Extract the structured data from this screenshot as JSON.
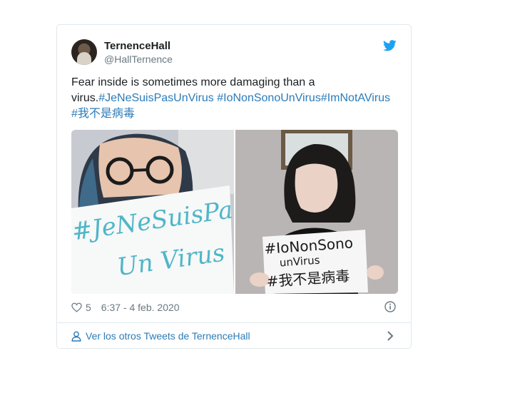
{
  "tweet": {
    "author_name": "TernenceHall",
    "author_handle": "@HallTernence",
    "text_plain": "Fear inside is sometimes more damaging than a virus.",
    "hashtags": [
      "#JeNeSuisPasUnVirus",
      "#IoNonSonoUnVirus",
      "#ImNotAVirus",
      "#我不是病毒"
    ],
    "likes": "5",
    "timestamp": "6:37 - 4 feb. 2020"
  },
  "media": {
    "photo1_sign": [
      "#JeNeSuisPas",
      "Un Virus"
    ],
    "photo2_sign": [
      "#IoNonSono",
      "unVirus",
      "#我不是病毒"
    ]
  },
  "footer": {
    "link_text": "Ver los otros Tweets de TernenceHall"
  },
  "icons": {
    "bird": "twitter-bird-icon",
    "heart": "heart-icon",
    "info": "info-icon",
    "person": "person-icon",
    "chevron": "chevron-right-icon"
  },
  "colors": {
    "link": "#2b7bb9",
    "secondary": "#697882",
    "twitter_blue": "#1da1f2",
    "border": "#e1e8ed"
  }
}
